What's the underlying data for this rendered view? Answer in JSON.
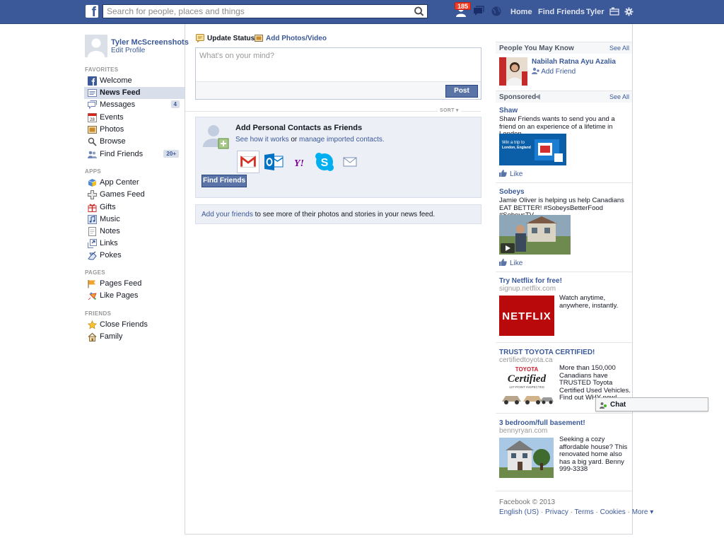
{
  "topbar": {
    "search_placeholder": "Search for people, places and things",
    "notification_count": "185",
    "nav_home": "Home",
    "nav_find_friends": "Find Friends",
    "nav_user": "Tyler"
  },
  "sidebar": {
    "user_name": "Tyler McScreenshots",
    "edit_profile": "Edit Profile",
    "favorites_heading": "FAVORITES",
    "favorites": [
      {
        "label": "Welcome",
        "icon": "facebook-icon"
      },
      {
        "label": "News Feed",
        "icon": "news-feed-icon"
      },
      {
        "label": "Messages",
        "icon": "messages-icon",
        "count": "4"
      },
      {
        "label": "Events",
        "icon": "calendar-icon"
      },
      {
        "label": "Photos",
        "icon": "photos-icon"
      },
      {
        "label": "Browse",
        "icon": "search-icon"
      },
      {
        "label": "Find Friends",
        "icon": "friends-icon",
        "count": "20+"
      }
    ],
    "apps_heading": "APPS",
    "apps": [
      {
        "label": "App Center",
        "icon": "app-center-icon"
      },
      {
        "label": "Games Feed",
        "icon": "games-icon"
      },
      {
        "label": "Gifts",
        "icon": "gift-icon"
      },
      {
        "label": "Music",
        "icon": "music-icon"
      },
      {
        "label": "Notes",
        "icon": "notes-icon"
      },
      {
        "label": "Links",
        "icon": "links-icon"
      },
      {
        "label": "Pokes",
        "icon": "poke-icon"
      }
    ],
    "pages_heading": "PAGES",
    "pages": [
      {
        "label": "Pages Feed",
        "icon": "pages-feed-icon"
      },
      {
        "label": "Like Pages",
        "icon": "like-pages-icon"
      }
    ],
    "friends_heading": "FRIENDS",
    "friends": [
      {
        "label": "Close Friends",
        "icon": "star-icon"
      },
      {
        "label": "Family",
        "icon": "home-icon"
      }
    ]
  },
  "composer": {
    "tab_status": "Update Status",
    "tab_photo": "Add Photos/Video",
    "placeholder": "What's on your mind?",
    "post_label": "Post"
  },
  "feed": {
    "sort_label": "SORT ▾"
  },
  "friend_finder": {
    "title": "Add Personal Contacts as Friends",
    "link_how": "See how it works",
    "or_text": " or ",
    "link_manage": "manage imported contacts.",
    "providers": [
      "gmail-icon",
      "outlook-icon",
      "yahoo-icon",
      "skype-icon",
      "email-icon"
    ],
    "button": "Find Friends"
  },
  "add_friends_box": {
    "link": "Add your friends",
    "text": " to see more of their photos and stories in your news feed."
  },
  "right_column": {
    "pymk_heading": "People You May Know",
    "pymk_see_all": "See All",
    "pymk_name": "Nabilah Ratna Ayu Azalia",
    "pymk_add": "Add Friend",
    "sponsored_heading": "Sponsored",
    "sponsored_see_all": "See All",
    "like_label": "Like",
    "ads": [
      {
        "title": "Shaw",
        "text": "Shaw Friends wants to send you and a friend on an experience of a lifetime in London,..."
      },
      {
        "title": "Sobeys",
        "text": "Jamie Oliver is helping us help Canadians EAT BETTER! #SobeysBetterFood #SobeysTV..."
      },
      {
        "title": "Try Netflix for free!",
        "url": "signup.netflix.com",
        "text": "Watch anytime, anywhere, instantly.",
        "logo": "NETFLIX"
      },
      {
        "title": "TRUST TOYOTA CERTIFIED!",
        "url": "certifiedtoyota.ca",
        "text": "More than 150,000 Canadians have TRUSTED Toyota Certified Used Vehicles. Find out WHY now!"
      },
      {
        "title": "3 bedroom/full basement!",
        "url": "bennyryan.com",
        "text": "Seeking a cozy affordable house? This renovated home also has a big yard. Benny 999-3338"
      }
    ],
    "shaw_banner_line1": "Win a trip to",
    "shaw_banner_line2": "London, England",
    "toyota_brand": "TOYOTA",
    "toyota_cert": "Certified",
    "toyota_sub": "127-POINT INSPECTED"
  },
  "chat": {
    "label": "Chat"
  },
  "footer": {
    "copyright": "Facebook © 2013",
    "links": [
      "English (US)",
      "Privacy",
      "Terms",
      "Cookies",
      "More ▾"
    ]
  },
  "colors": {
    "brand": "#3b5998",
    "badge": "#f03d25",
    "button": "#5b74a8"
  }
}
